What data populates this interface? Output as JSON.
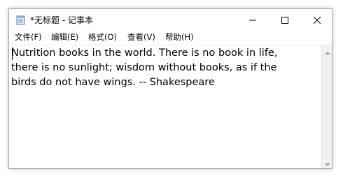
{
  "window": {
    "title": "*无标题 - 记事本"
  },
  "controls": {
    "minimize_icon": "minimize-icon",
    "maximize_icon": "maximize-icon",
    "close_icon": "close-icon"
  },
  "menu": {
    "items": [
      {
        "label": "文件(F)"
      },
      {
        "label": "编辑(E)"
      },
      {
        "label": "格式(O)"
      },
      {
        "label": "查看(V)"
      },
      {
        "label": "帮助(H)"
      }
    ]
  },
  "editor": {
    "content": "Nutrition books in the world. There is no book in life,\nthere is no sunlight; wisdom without books, as if the\nbirds do not have wings. -- Shakespeare"
  },
  "colors": {
    "window_border": "#aaaaaa",
    "scrollbar_track": "#f0f0f0",
    "text": "#000000"
  }
}
